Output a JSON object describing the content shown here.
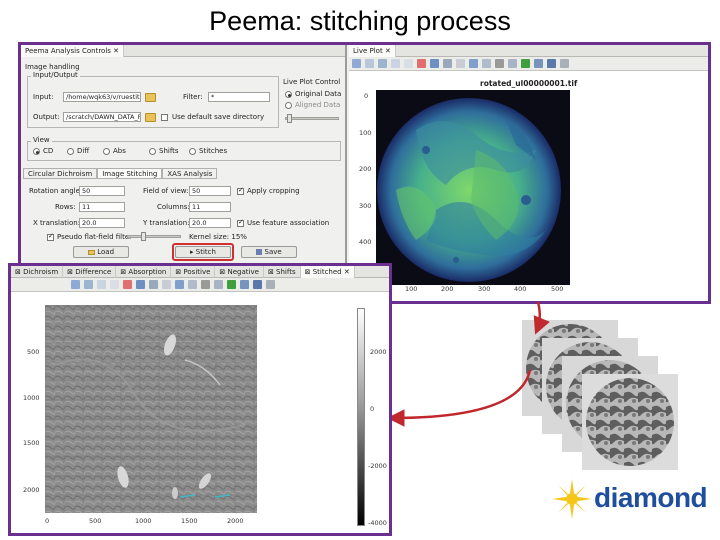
{
  "slide": {
    "title": "Peema: stitching process"
  },
  "analysis_window": {
    "title": "Peema Analysis Controls",
    "image_handling": {
      "group_label": "Image handling",
      "io_label": "Input/Output",
      "input_label": "Input:",
      "input_value": "/home/wqk63/v/ruestit",
      "filter_label": "Filter:",
      "filter_value": "*",
      "output_label": "Output:",
      "output_value": "/scratch/DAWN_DATA_P",
      "default_save_label": "Use default save directory"
    },
    "live_plot_control": {
      "label": "Live Plot Control",
      "original_data": "Original Data",
      "aligned_data": "Aligned Data"
    },
    "view": {
      "label": "View",
      "options": [
        "CD",
        "Diff",
        "Abs",
        "Shifts",
        "Stitches"
      ]
    },
    "tabs": [
      "Circular Dichroism",
      "Image Stitching",
      "XAS Analysis"
    ],
    "stitching": {
      "rotation_label": "Rotation angle:",
      "rotation_value": "50",
      "fov_label": "Field of view:",
      "fov_value": "50",
      "cropping_label": "Apply cropping",
      "rows_label": "Rows:",
      "rows_value": "11",
      "columns_label": "Columns:",
      "columns_value": "11",
      "x_translation_label": "X translation:",
      "x_translation_value": "20.0",
      "y_translation_label": "Y translation:",
      "y_translation_value": "20.0",
      "feature_label": "Use feature association",
      "pseudo_label": "Pseudo flat-field filter",
      "kernel_label": "Kernel size: 15%"
    },
    "buttons": {
      "load": "Load",
      "stitch": "Stitch",
      "save": "Save"
    }
  },
  "live_plot": {
    "title": "Live Plot",
    "filename": "rotated_ul00000001.tif",
    "y_ticks": [
      "0",
      "100",
      "200",
      "300",
      "400"
    ],
    "x_ticks": [
      "100",
      "200",
      "300",
      "400",
      "500"
    ]
  },
  "stitched_window": {
    "tabs": [
      "Dichroism",
      "Difference",
      "Absorption",
      "Positive",
      "Negative",
      "Shifts",
      "Stitched"
    ],
    "y_ticks": [
      "500",
      "1000",
      "1500",
      "2000"
    ],
    "x_ticks": [
      "0",
      "500",
      "1000",
      "1500",
      "2000"
    ],
    "colorbar_ticks": [
      "2000",
      "0",
      "-2000",
      "-4000"
    ]
  },
  "logo": {
    "text": "diamond"
  },
  "colors": {
    "frame": "#6b2f8f",
    "arrow": "#c0282d",
    "highlight": "#d03030",
    "logo_blue": "#1f4e9c",
    "logo_yellow": "#f5c518"
  }
}
